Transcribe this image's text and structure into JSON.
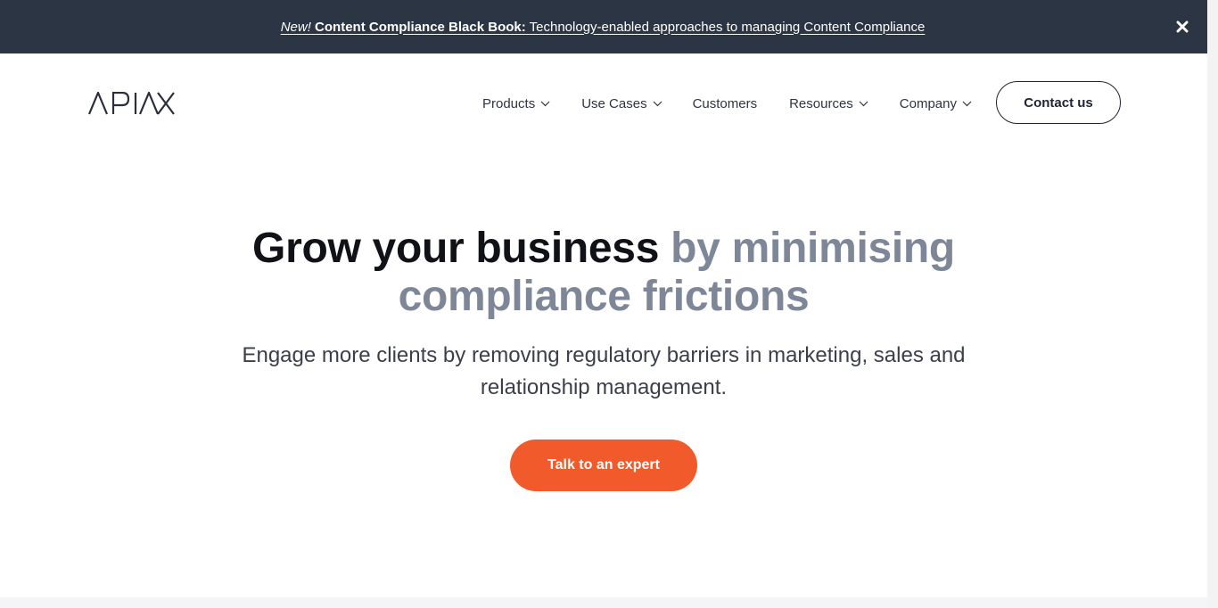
{
  "announcement": {
    "new_label": "New!",
    "title": "Content Compliance Black Book:",
    "text": "Technology-enabled approaches to managing Content Compliance",
    "close_icon": "close-icon",
    "background": "#2c3543"
  },
  "header": {
    "logo_text": "APIAX",
    "nav": [
      {
        "label": "Products",
        "has_dropdown": true
      },
      {
        "label": "Use Cases",
        "has_dropdown": true
      },
      {
        "label": "Customers",
        "has_dropdown": false
      },
      {
        "label": "Resources",
        "has_dropdown": true
      },
      {
        "label": "Company",
        "has_dropdown": true
      }
    ],
    "contact_label": "Contact us"
  },
  "hero": {
    "title_dark": "Grow your business",
    "title_accent": "by minimising compliance frictions",
    "subtitle": "Engage more clients by removing regulatory barriers in marketing, sales and relationship management.",
    "cta_label": "Talk to an expert"
  },
  "colors": {
    "accent_gray": "#7d8797",
    "cta_orange": "#f15a2b",
    "text_dark": "#101217"
  }
}
